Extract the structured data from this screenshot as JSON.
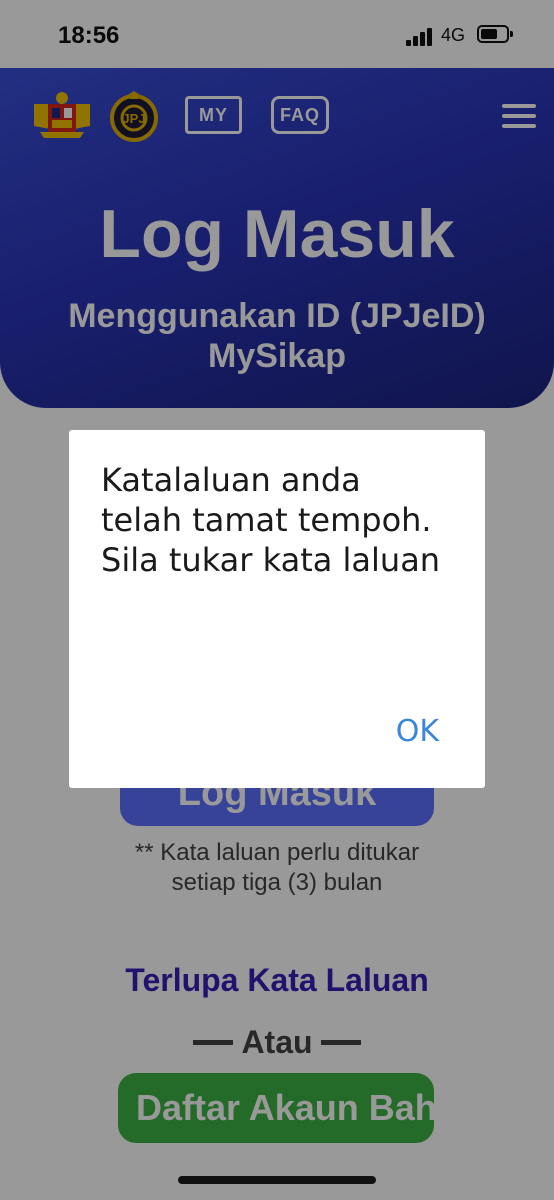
{
  "status_bar": {
    "time": "18:56",
    "network": "4G"
  },
  "header": {
    "my_label": "MY",
    "faq_label": "FAQ",
    "title": "Log Masuk",
    "subtitle": "Menggunakan ID (JPJeID) MySikap",
    "icons": [
      "malaysia-crest-icon",
      "jpj-emblem-icon",
      "menu-icon"
    ]
  },
  "form": {
    "login_button": "Log Masuk",
    "password_note": "** Kata laluan perlu ditukar setiap tiga (3) bulan",
    "forgot_password": "Terlupa Kata Laluan",
    "or_divider": "Atau",
    "register_button": "Daftar Akaun Baharu"
  },
  "dialog": {
    "message": "Katalaluan anda telah tamat tempoh. Sila tukar kata laluan",
    "ok_label": "OK"
  },
  "colors": {
    "header": "#2a35b8",
    "login_button": "#5b70ff",
    "register_button": "#3db346",
    "forgot_text": "#3a1fb8",
    "dialog_ok": "#3b86d8"
  }
}
